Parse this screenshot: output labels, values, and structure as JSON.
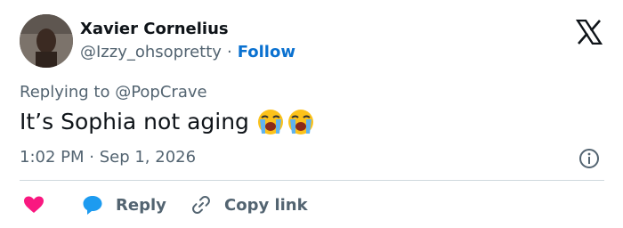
{
  "author": {
    "name": "Xavier Cornelius",
    "handle": "@Izzy_ohsopretty",
    "separator": "·",
    "follow_label": "Follow"
  },
  "reply_context": {
    "prefix": "Replying to ",
    "target": "@PopCrave"
  },
  "tweet": {
    "text": "It’s Sophia not aging",
    "emojis": [
      "loudly-crying-face",
      "loudly-crying-face"
    ],
    "timestamp": "1:02 PM · Sep 1, 2026"
  },
  "actions": {
    "reply_label": "Reply",
    "copy_label": "Copy link"
  },
  "colors": {
    "like": "#f91880",
    "reply": "#1d9bf0",
    "follow": "#0a71d0",
    "secondary_text": "#536471"
  },
  "icons": {
    "brand": "x-logo-icon",
    "info": "info-icon",
    "like": "heart-icon",
    "reply": "speech-bubble-icon",
    "copy": "link-icon"
  }
}
